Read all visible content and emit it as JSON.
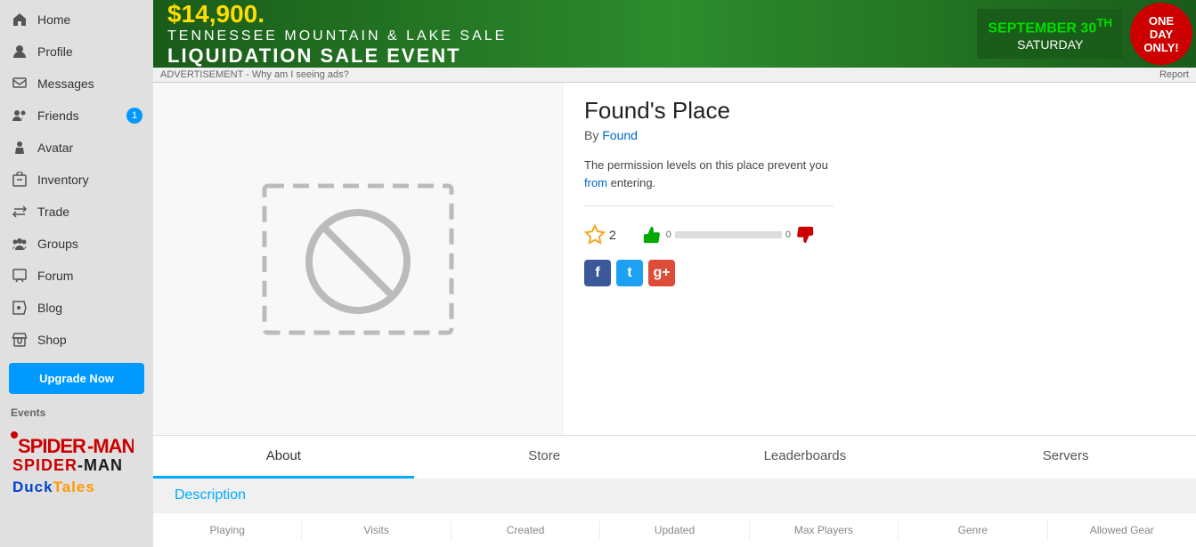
{
  "sidebar": {
    "items": [
      {
        "label": "Home",
        "icon": "home-icon"
      },
      {
        "label": "Profile",
        "icon": "profile-icon"
      },
      {
        "label": "Messages",
        "icon": "messages-icon"
      },
      {
        "label": "Friends",
        "icon": "friends-icon",
        "badge": "1"
      },
      {
        "label": "Avatar",
        "icon": "avatar-icon"
      },
      {
        "label": "Inventory",
        "icon": "inventory-icon"
      },
      {
        "label": "Trade",
        "icon": "trade-icon"
      },
      {
        "label": "Groups",
        "icon": "groups-icon"
      },
      {
        "label": "Forum",
        "icon": "forum-icon"
      },
      {
        "label": "Blog",
        "icon": "blog-icon"
      },
      {
        "label": "Shop",
        "icon": "shop-icon"
      }
    ],
    "upgrade_button": "Upgrade Now",
    "events_label": "Events"
  },
  "ad": {
    "price": "$14,900.",
    "subtitle": "TENNESSEE MOUNTAIN & LAKE SALE",
    "event_name": "LIQUIDATION SALE EVENT",
    "side_text": "SEPTEMBER 30TH\nSATURDAY",
    "one_day": "ONE\nDAY\nONLY!",
    "label": "ADVERTISEMENT - Why am I seeing ads?",
    "report": "Report"
  },
  "place": {
    "title": "Found's Place",
    "by_label": "By",
    "author": "Found",
    "permission_text": "The permission levels on this place prevent you from entering.",
    "from_text": "from",
    "star_count": "2",
    "thumb_up_count": "0",
    "thumb_down_count": "0"
  },
  "tabs": [
    {
      "label": "About",
      "active": true
    },
    {
      "label": "Store",
      "active": false
    },
    {
      "label": "Leaderboards",
      "active": false
    },
    {
      "label": "Servers",
      "active": false
    }
  ],
  "description": {
    "heading": "Description"
  },
  "stats": {
    "columns": [
      "Playing",
      "Visits",
      "Created",
      "Updated",
      "Max Players",
      "Genre",
      "Allowed Gear"
    ]
  },
  "events": [
    {
      "name": "Spider-Man",
      "style": "spiderman"
    },
    {
      "name": "DuckTales",
      "style": "ducktales"
    }
  ]
}
